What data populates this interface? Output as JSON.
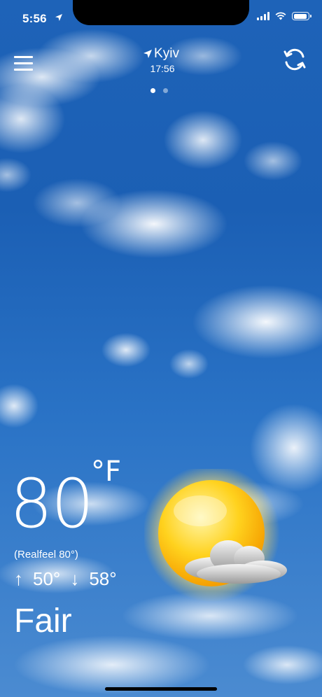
{
  "status_bar": {
    "time": "5:56"
  },
  "header": {
    "city": "Kyiv",
    "local_time": "17:56"
  },
  "pager": {
    "count": 2,
    "active_index": 0
  },
  "weather": {
    "temperature": "80",
    "unit": "°F",
    "realfeel": "(Realfeel 80°)",
    "low": "50°",
    "high": "58°",
    "condition": "Fair",
    "icon": "sun-with-cloud-icon"
  },
  "icons": {
    "menu": "hamburger-menu-icon",
    "refresh": "refresh-icon",
    "location": "location-arrow-icon"
  }
}
